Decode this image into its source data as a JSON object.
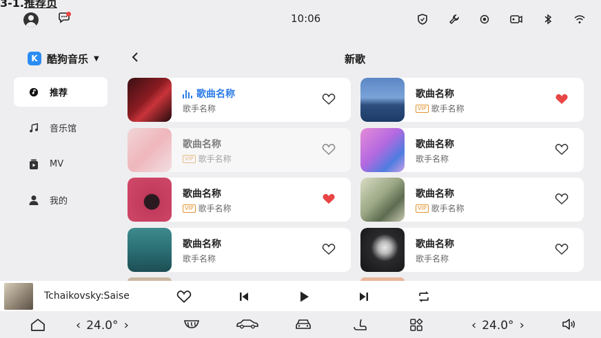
{
  "top_fragment": {
    "prefix": "3-1.",
    "label": "推荐页"
  },
  "status": {
    "time": "10:06",
    "icons": [
      "shield-icon",
      "wrench-icon",
      "record-icon",
      "camera-icon",
      "bluetooth-icon",
      "wifi-icon"
    ]
  },
  "brand": {
    "name": "酷狗音乐",
    "logo_letter": "K"
  },
  "sidebar": {
    "items": [
      {
        "label": "推荐",
        "icon": "disc-icon",
        "active": true
      },
      {
        "label": "音乐馆",
        "icon": "music-note-icon",
        "active": false
      },
      {
        "label": "MV",
        "icon": "video-icon",
        "active": false
      },
      {
        "label": "我的",
        "icon": "person-icon",
        "active": false
      }
    ]
  },
  "header": {
    "title": "新歌",
    "back_icon": "back-arrow-icon"
  },
  "songs": [
    {
      "title": "歌曲名称",
      "artist": "歌手名称",
      "vip": false,
      "liked": false,
      "playing": true
    },
    {
      "title": "歌曲名称",
      "artist": "歌手名称",
      "vip": true,
      "liked": true,
      "playing": false
    },
    {
      "title": "歌曲名称",
      "artist": "歌手名称",
      "vip": true,
      "liked": false,
      "playing": false,
      "faded": true
    },
    {
      "title": "歌曲名称",
      "artist": "歌手名称",
      "vip": false,
      "liked": false,
      "playing": false
    },
    {
      "title": "歌曲名称",
      "artist": "歌手名称",
      "vip": true,
      "liked": true,
      "playing": false
    },
    {
      "title": "歌曲名称",
      "artist": "歌手名称",
      "vip": true,
      "liked": false,
      "playing": false
    },
    {
      "title": "歌曲名称",
      "artist": "歌手名称",
      "vip": false,
      "liked": false,
      "playing": false
    },
    {
      "title": "歌曲名称",
      "artist": "歌手名称",
      "vip": false,
      "liked": false,
      "playing": false
    }
  ],
  "vip_badge": "VIP",
  "player": {
    "track": "Tchaikovsky:Saise"
  },
  "car": {
    "left_temp": "24.0°",
    "right_temp": "24.0°"
  },
  "colors": {
    "accent": "#2b7be6",
    "heart_liked": "#e84545",
    "background": "#eeeef0",
    "card": "#ffffff"
  }
}
